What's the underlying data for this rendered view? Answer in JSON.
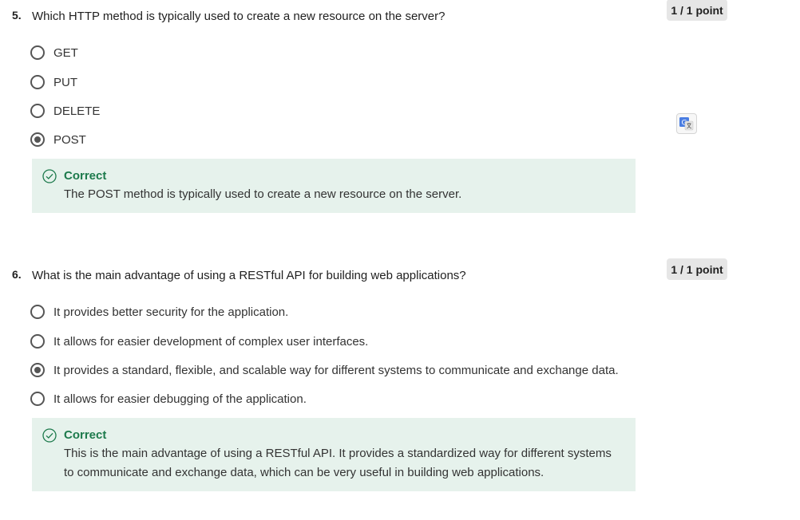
{
  "questions": [
    {
      "number": "5.",
      "text": "Which HTTP method is typically used to create a new resource on the server?",
      "points": "1 / 1 point",
      "options": [
        {
          "label": "GET",
          "selected": false
        },
        {
          "label": "PUT",
          "selected": false
        },
        {
          "label": "DELETE",
          "selected": false
        },
        {
          "label": "POST",
          "selected": true
        }
      ],
      "feedback": {
        "title": "Correct",
        "text": "The POST method is typically used to create a new resource on the server."
      }
    },
    {
      "number": "6.",
      "text": "What is the main advantage of using a RESTful API for building web applications?",
      "points": "1 / 1 point",
      "options": [
        {
          "label": "It provides better security for the application.",
          "selected": false
        },
        {
          "label": "It allows for easier development of complex user interfaces.",
          "selected": false
        },
        {
          "label": "It provides a standard, flexible, and scalable way for different systems to communicate and exchange data.",
          "selected": true
        },
        {
          "label": "It allows for easier debugging of the application.",
          "selected": false
        }
      ],
      "feedback": {
        "title": "Correct",
        "text": "This is the main advantage of using a RESTful API. It provides a standardized way for different systems to communicate and exchange data, which can be very useful in building web applications."
      }
    }
  ],
  "translate_icon": "google-translate-icon",
  "colors": {
    "correct_text": "#1d7a4c",
    "feedback_bg": "#e6f2ec",
    "points_bg": "#e6e6e6"
  }
}
